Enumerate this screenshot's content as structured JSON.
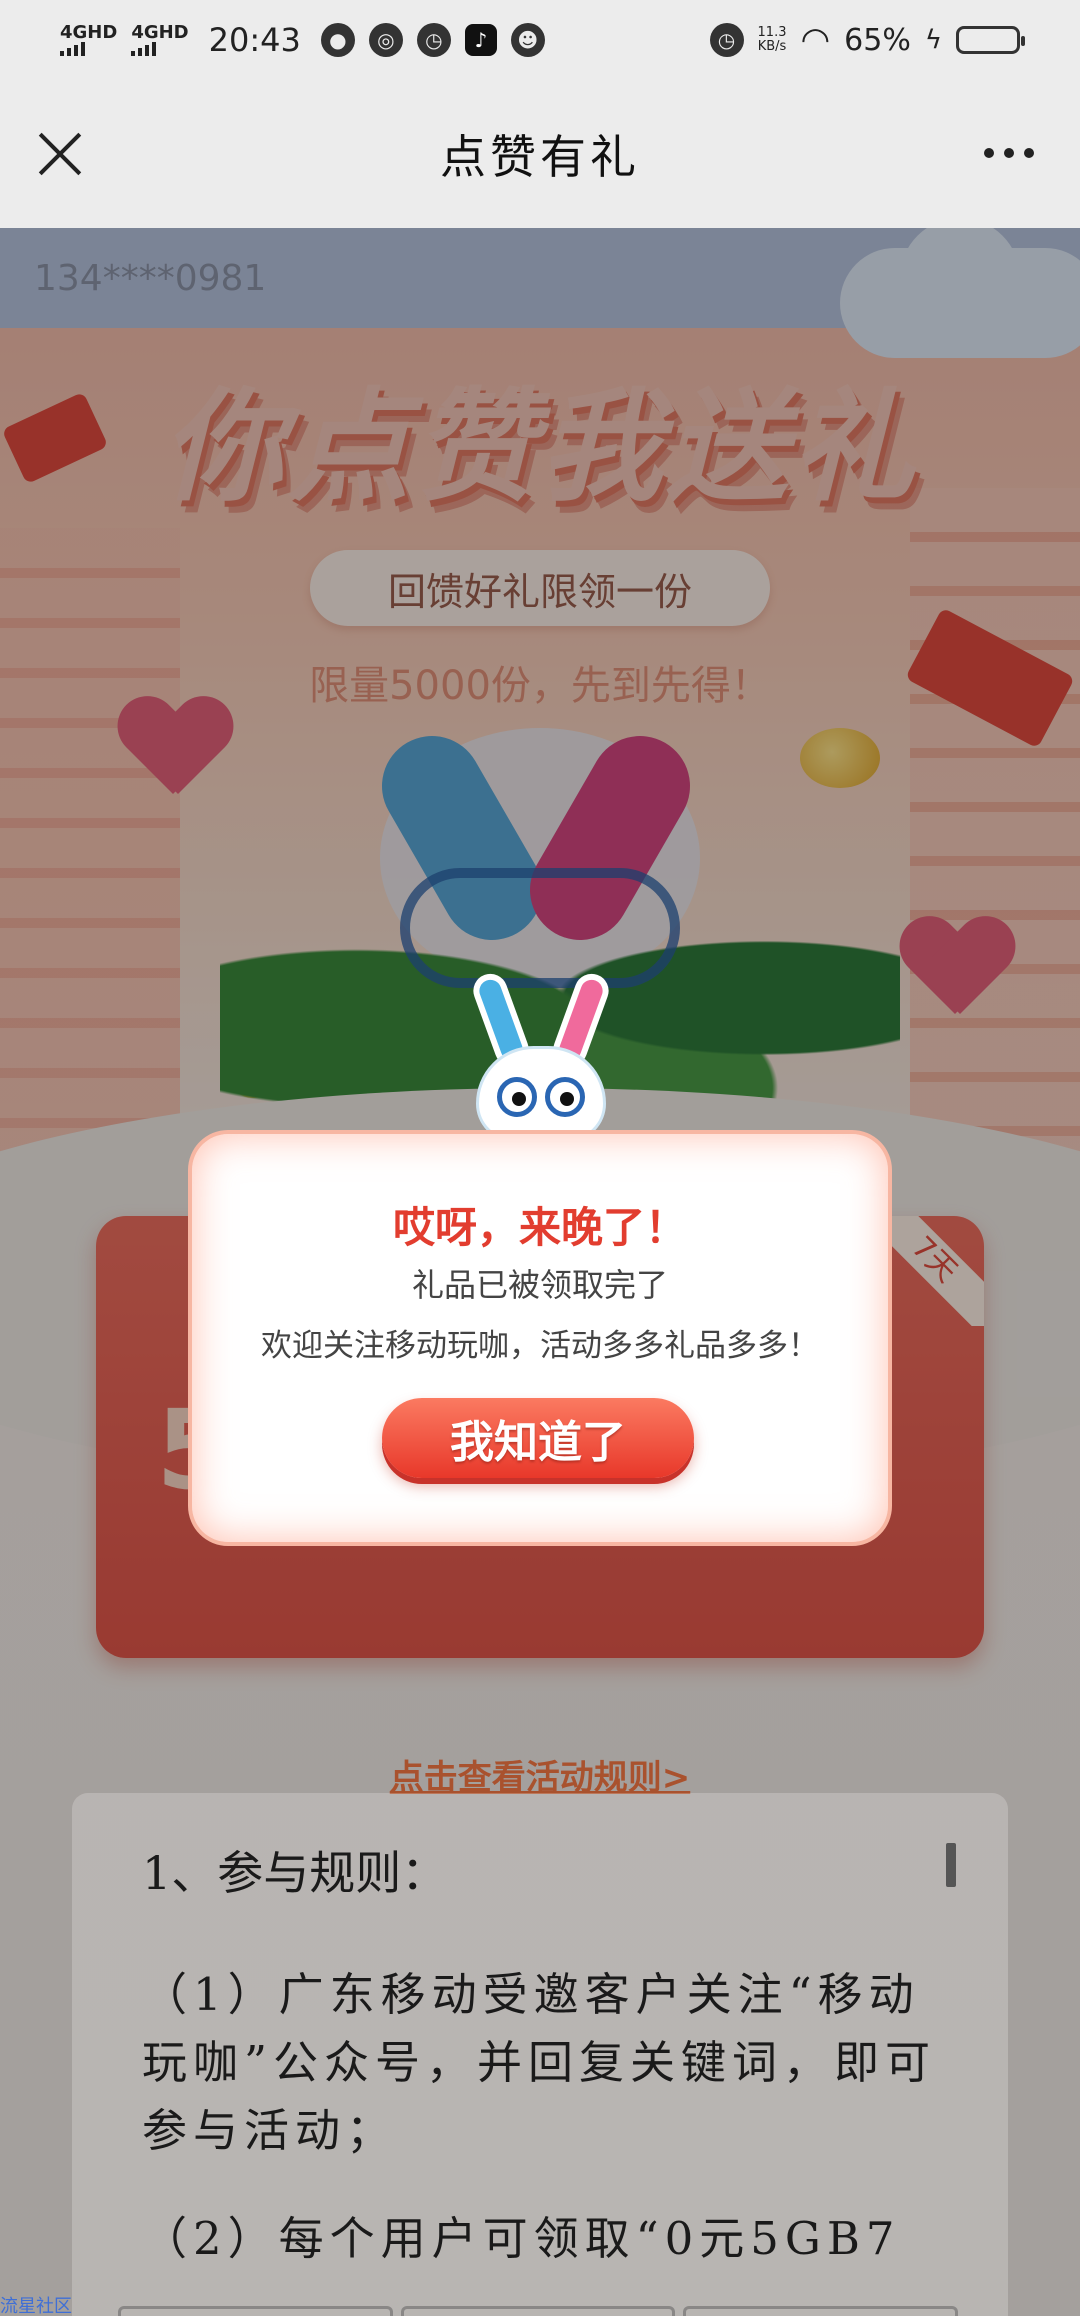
{
  "status_bar": {
    "signal1": "4GHD",
    "signal2": "4GHD",
    "time": "20:43",
    "net_speed_value": "11.3",
    "net_speed_unit": "KB/s",
    "battery_percent": "65%",
    "battery_level": 0.65
  },
  "title_bar": {
    "title": "点赞有礼"
  },
  "page": {
    "phone_number": "134****0981",
    "headline": "你点赞我送礼",
    "pill_text": "回馈好礼限领一份",
    "limit_text": "限量5000份，先到先得！",
    "card_ribbon": "7天",
    "card_number": "5"
  },
  "modal": {
    "title": "哎呀，来晚了！",
    "subtitle": "礼品已被领取完了",
    "description": "欢迎关注移动玩咖，活动多多礼品多多！",
    "button_label": "我知道了"
  },
  "rules": {
    "link_text": "点击查看活动规则>",
    "heading": "1、参与规则：",
    "paragraphs": [
      "（1）广东移动受邀客户关注“移动玩咖”公众号，并回复关键词，即可参与活动；",
      "（2）每个用户可领取“0元5GB7"
    ]
  },
  "watermark": "流星社区",
  "colors": {
    "accent_red": "#e23d2f",
    "button_red": "#e8382a",
    "link_brown": "#a9522e",
    "status_bg": "#ececec"
  }
}
